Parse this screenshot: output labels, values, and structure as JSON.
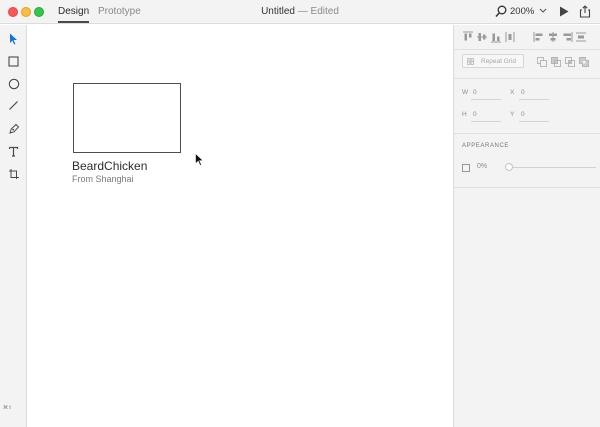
{
  "window": {
    "tabs": [
      {
        "label": "Design",
        "active": true
      },
      {
        "label": "Prototype",
        "active": false
      }
    ],
    "doc_name": "Untitled",
    "doc_separator": "—",
    "doc_status": "Edited",
    "zoom": "200%"
  },
  "toolbar": {
    "tools": [
      "select-icon",
      "rectangle-icon",
      "ellipse-icon",
      "line-icon",
      "pen-icon",
      "text-icon",
      "artboard-icon"
    ],
    "active_tool": "select-icon",
    "bottom_label": "⌘⇧"
  },
  "canvas": {
    "title": "BeardChicken",
    "subtitle": "From Shanghai"
  },
  "inspector": {
    "repeat_grid_label": "Repeat Grid",
    "width_label": "W",
    "width_value": "0",
    "x_label": "X",
    "x_value": "0",
    "height_label": "H",
    "height_value": "0",
    "y_label": "Y",
    "y_value": "0",
    "appearance_label": "APPEARANCE",
    "opacity_value": "0%"
  },
  "colors": {
    "accent": "#1473e6",
    "chrome": "#f3f3f3",
    "border": "#dcdcdc"
  }
}
